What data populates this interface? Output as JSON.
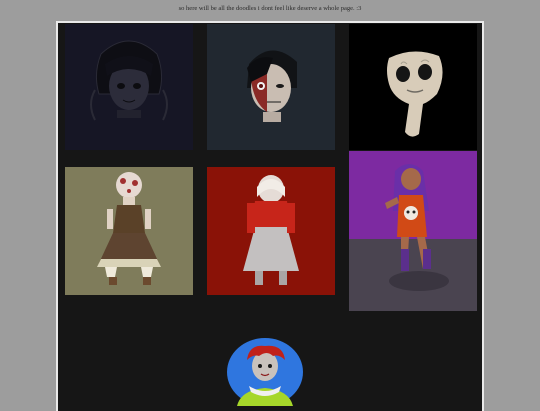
{
  "page": {
    "caption": "so here will be all the doodles i dont feel like deserve a whole page. :3"
  },
  "colors": {
    "page_background": "#9d9d9d",
    "panel_background": "#161616",
    "panel_border": "#e9e9e9"
  },
  "gallery": [
    {
      "name": "doodle-dark-sketch-portrait",
      "icon": "dark-haired-character-sketch"
    },
    {
      "name": "doodle-split-face-portrait",
      "icon": "half-torn-face-character"
    },
    {
      "name": "doodle-pale-creature",
      "icon": "pale-hollow-eyed-creature"
    },
    {
      "name": "doodle-lolita-doll",
      "icon": "doll-in-brown-dress"
    },
    {
      "name": "doodle-red-hood-girl",
      "icon": "girl-in-red-hood"
    },
    {
      "name": "doodle-purple-hair-girl",
      "icon": "purple-haired-girl-holding-skull"
    },
    {
      "name": "doodle-red-haired-clown",
      "icon": "red-haired-clown-circle"
    }
  ]
}
